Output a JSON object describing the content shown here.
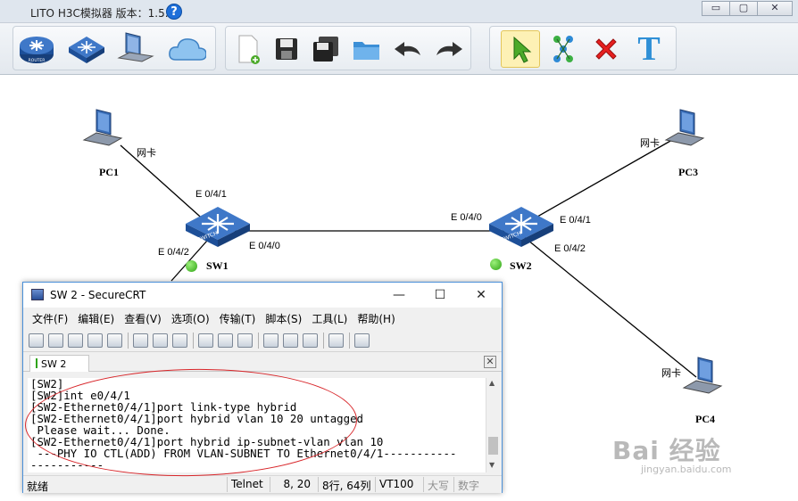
{
  "window": {
    "title": "LITO H3C模拟器 版本：1.5.2",
    "help": "?",
    "controls": [
      "▭",
      "▢",
      "✕"
    ]
  },
  "toolbar": {
    "router_label": "ROUTER",
    "switch_label": "SWITCH",
    "text_tool": "T"
  },
  "topology": {
    "nodes": {
      "pc1": "PC1",
      "pc3": "PC3",
      "pc4": "PC4",
      "sw1": "SW1",
      "sw2": "SW2",
      "switch_badge": "SWITCH"
    },
    "nic_label": "网卡",
    "ports": {
      "sw1_e041": "E 0/4/1",
      "sw1_e042": "E 0/4/2",
      "sw1_e040": "E 0/4/0",
      "sw2_e040": "E 0/4/0",
      "sw2_e041": "E 0/4/1",
      "sw2_e042": "E 0/4/2"
    }
  },
  "securecrt": {
    "title": "SW 2 - SecureCRT",
    "controls": [
      "—",
      "☐",
      "✕"
    ],
    "menu": [
      "文件(F)",
      "编辑(E)",
      "查看(V)",
      "选项(O)",
      "传输(T)",
      "脚本(S)",
      "工具(L)",
      "帮助(H)"
    ],
    "tab": "SW 2",
    "tab_close": "✕",
    "terminal_lines": [
      "[SW2]",
      "[SW2]int e0/4/1",
      "[SW2-Ethernet0/4/1]port link-type hybrid",
      "[SW2-Ethernet0/4/1]port hybrid vlan 10 20 untagged",
      " Please wait... Done.",
      "[SW2-Ethernet0/4/1]port hybrid ip-subnet-vlan vlan 10",
      " ---PHY IO CTL(ADD) FROM VLAN-SUBNET TO Ethernet0/4/1-----------",
      "-----------"
    ],
    "status": {
      "ready": "就绪",
      "protocol": "Telnet",
      "cursor": "8,  20",
      "rowcol": "8行, 64列",
      "emulation": "VT100",
      "caps": "大写",
      "num": "数字"
    }
  },
  "watermark": {
    "brand": "Bai 经验",
    "url": "jingyan.baidu.com"
  }
}
